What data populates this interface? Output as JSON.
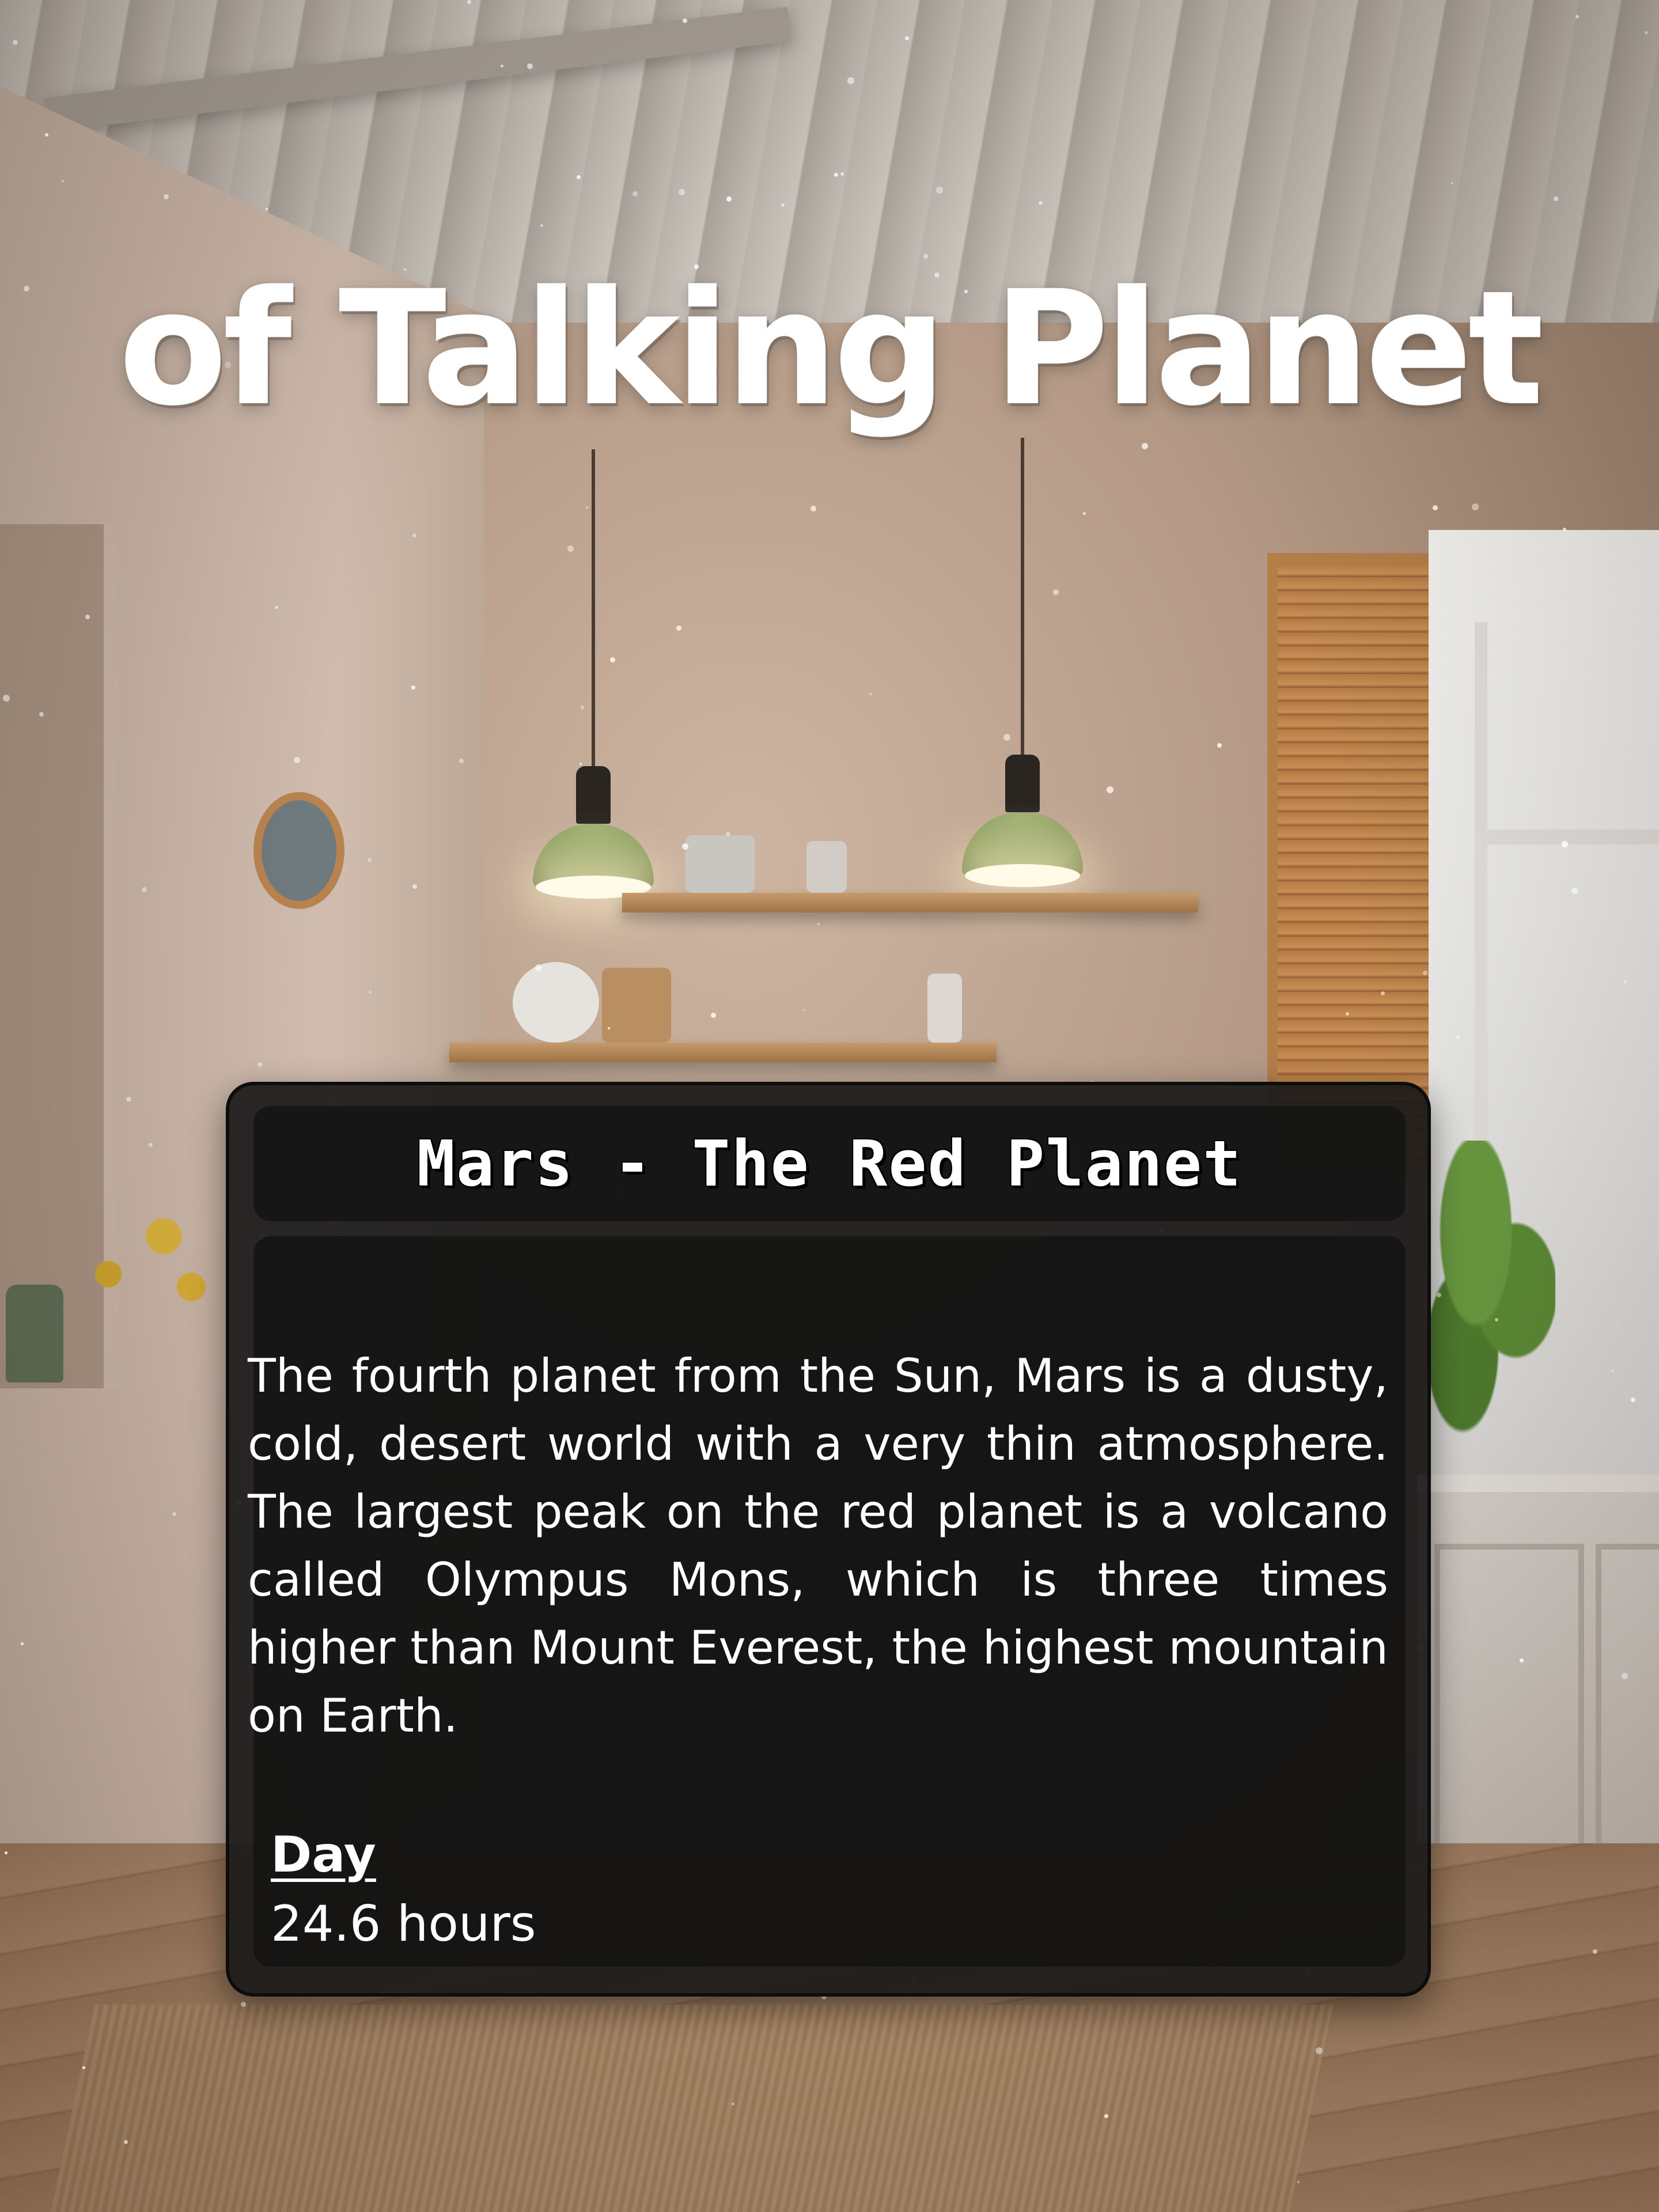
{
  "app": {
    "title": "of Talking Planet"
  },
  "card": {
    "title": "Mars - The Red Planet",
    "description": "The fourth planet from the Sun, Mars is a dusty, cold, desert world with a very thin atmosphere. The largest peak on the red planet is a volcano called Olympus Mons, which is three times higher than Mount Everest, the highest mountain on Earth.",
    "stats": [
      {
        "label": "Day",
        "value": "24.6 hours"
      }
    ]
  },
  "theme": {
    "card_background": "#1a1919",
    "text_color": "#ffffff"
  }
}
